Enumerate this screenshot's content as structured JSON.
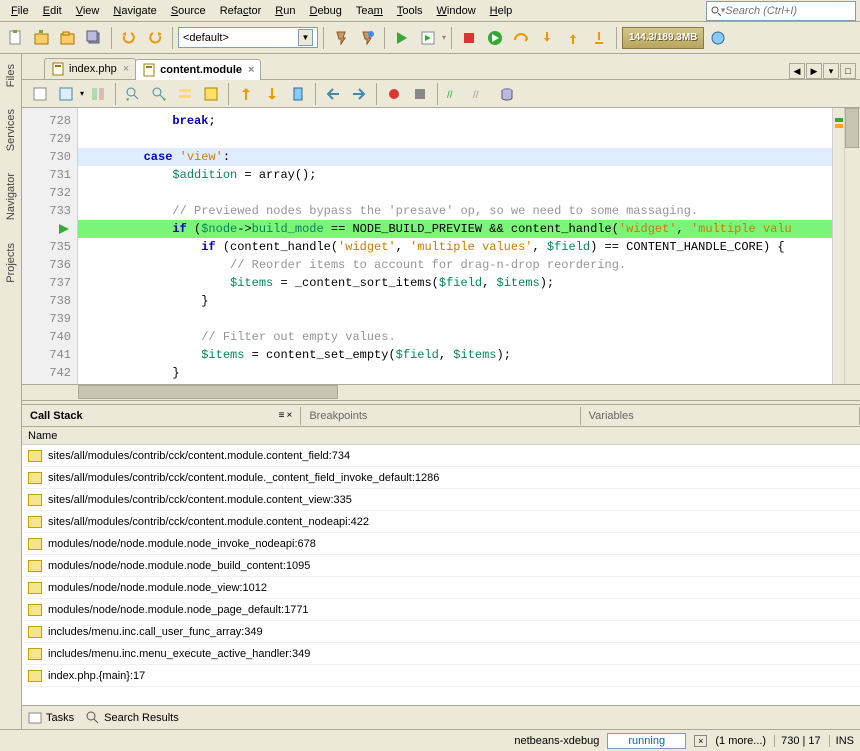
{
  "menus": [
    "File",
    "Edit",
    "View",
    "Navigate",
    "Source",
    "Refactor",
    "Run",
    "Debug",
    "Team",
    "Tools",
    "Window",
    "Help"
  ],
  "menu_underline_idx": [
    0,
    0,
    0,
    0,
    0,
    4,
    0,
    0,
    3,
    0,
    0,
    0
  ],
  "search_placeholder": "Search (Ctrl+I)",
  "config_combo": "<default>",
  "memory": "144.3/189.3MB",
  "tabs": [
    {
      "label": "index.php",
      "active": false
    },
    {
      "label": "content.module",
      "active": true
    }
  ],
  "line_numbers": [
    "728",
    "729",
    "730",
    "731",
    "732",
    "733",
    "",
    "735",
    "736",
    "737",
    "738",
    "739",
    "740",
    "741",
    "742"
  ],
  "code_lines": [
    {
      "indent": 12,
      "parts": [
        {
          "t": "break",
          "c": "kw"
        },
        {
          "t": ";"
        }
      ]
    },
    {
      "indent": 0,
      "parts": []
    },
    {
      "hl": "hl-blue",
      "indent": 8,
      "parts": [
        {
          "t": "case ",
          "c": "kw"
        },
        {
          "t": "'view'",
          "c": "str"
        },
        {
          "t": ":"
        }
      ]
    },
    {
      "indent": 12,
      "parts": [
        {
          "t": "$addition",
          "c": "var"
        },
        {
          "t": " = "
        },
        {
          "t": "array",
          "c": "func"
        },
        {
          "t": "();"
        }
      ]
    },
    {
      "indent": 0,
      "parts": []
    },
    {
      "indent": 12,
      "parts": [
        {
          "t": "// Previewed nodes bypass the 'presave' op, so we need to some massaging.",
          "c": "com"
        }
      ]
    },
    {
      "hl": "hl-green",
      "indent": 12,
      "parts": [
        {
          "t": "if ",
          "c": "kw"
        },
        {
          "t": "("
        },
        {
          "t": "$node",
          "c": "var"
        },
        {
          "t": "->"
        },
        {
          "t": "build_mode",
          "c": "var"
        },
        {
          "t": " == NODE_BUILD_PREVIEW && content_handle("
        },
        {
          "t": "'widget'",
          "c": "str"
        },
        {
          "t": ", "
        },
        {
          "t": "'multiple valu",
          "c": "str"
        }
      ]
    },
    {
      "indent": 16,
      "parts": [
        {
          "t": "if ",
          "c": "kw"
        },
        {
          "t": "(content_handle("
        },
        {
          "t": "'widget'",
          "c": "str"
        },
        {
          "t": ", "
        },
        {
          "t": "'multiple values'",
          "c": "str"
        },
        {
          "t": ", "
        },
        {
          "t": "$field",
          "c": "var"
        },
        {
          "t": ") == CONTENT_HANDLE_CORE) {"
        }
      ]
    },
    {
      "indent": 20,
      "parts": [
        {
          "t": "// Reorder items to account for drag-n-drop reordering.",
          "c": "com"
        }
      ]
    },
    {
      "indent": 20,
      "parts": [
        {
          "t": "$items",
          "c": "var"
        },
        {
          "t": " = _content_sort_items("
        },
        {
          "t": "$field",
          "c": "var"
        },
        {
          "t": ", "
        },
        {
          "t": "$items",
          "c": "var"
        },
        {
          "t": ");"
        }
      ]
    },
    {
      "indent": 16,
      "parts": [
        {
          "t": "}"
        }
      ]
    },
    {
      "indent": 0,
      "parts": []
    },
    {
      "indent": 16,
      "parts": [
        {
          "t": "// Filter out empty values.",
          "c": "com"
        }
      ]
    },
    {
      "indent": 16,
      "parts": [
        {
          "t": "$items",
          "c": "var"
        },
        {
          "t": " = content_set_empty("
        },
        {
          "t": "$field",
          "c": "var"
        },
        {
          "t": ", "
        },
        {
          "t": "$items",
          "c": "var"
        },
        {
          "t": ");"
        }
      ]
    },
    {
      "indent": 12,
      "parts": [
        {
          "t": "}"
        }
      ]
    }
  ],
  "panel_tabs": [
    "Call Stack",
    "Breakpoints",
    "Variables"
  ],
  "panel_header": "Name",
  "stack": [
    "sites/all/modules/contrib/cck/content.module.content_field:734",
    "sites/all/modules/contrib/cck/content.module._content_field_invoke_default:1286",
    "sites/all/modules/contrib/cck/content.module.content_view:335",
    "sites/all/modules/contrib/cck/content.module.content_nodeapi:422",
    "modules/node/node.module.node_invoke_nodeapi:678",
    "modules/node/node.module.node_build_content:1095",
    "modules/node/node.module.node_view:1012",
    "modules/node/node.module.node_page_default:1771",
    "includes/menu.inc.call_user_func_array:349",
    "includes/menu.inc.menu_execute_active_handler:349",
    "index.php.{main}:17"
  ],
  "bottom_tabs": [
    "Tasks",
    "Search Results"
  ],
  "status": {
    "session": "netbeans-xdebug",
    "state": "running",
    "more": "(1 more...)",
    "cursor": "730 | 17",
    "mode": "INS"
  },
  "side_tabs": [
    "Files",
    "Services",
    "Navigator",
    "Projects"
  ]
}
